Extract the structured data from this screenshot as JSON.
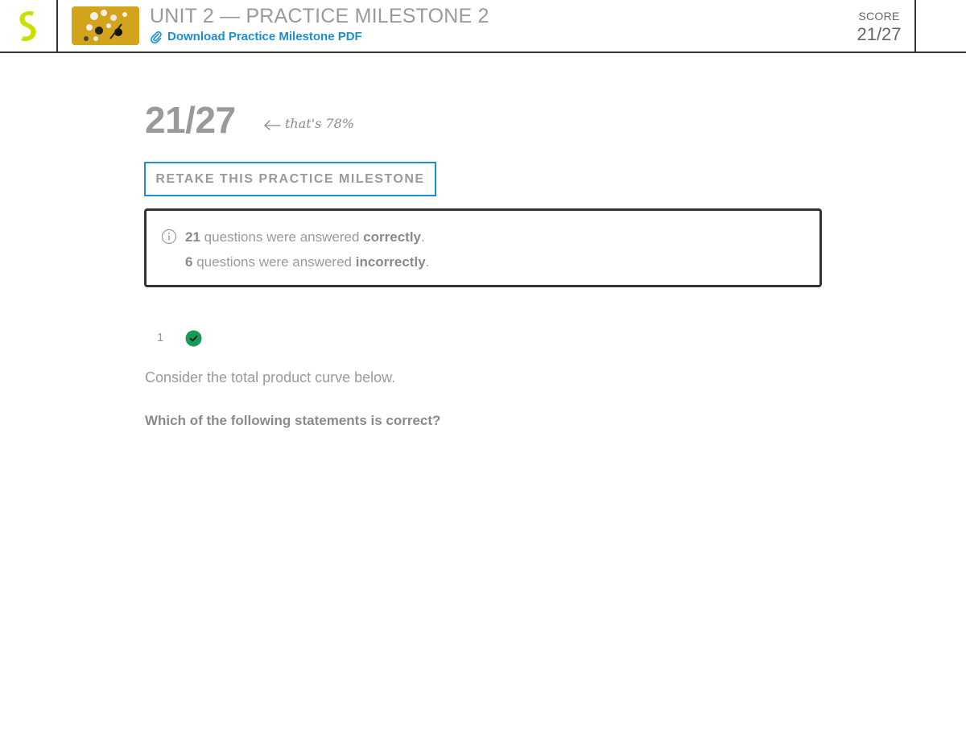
{
  "header": {
    "title": "UNIT 2 — PRACTICE MILESTONE 2",
    "download_label": "Download Practice Milestone PDF",
    "score_label": "SCORE",
    "score_value": "21/27"
  },
  "summary": {
    "score": "21/27",
    "percent_note": "that's 78%",
    "retake_label": "RETAKE THIS PRACTICE MILESTONE",
    "correct_count": "21",
    "correct_text": "questions were answered",
    "correct_word": "correctly",
    "incorrect_count": "6",
    "incorrect_text": "questions were answered",
    "incorrect_word": "incorrectly",
    "period": "."
  },
  "question": {
    "number": "1",
    "status": "correct",
    "text": "Consider the total product curve below.",
    "prompt": "Which of the following statements is correct?"
  },
  "colors": {
    "accent": "#1a8fd6",
    "logo": "#c8e000",
    "correct": "#1a9a5a",
    "border": "#333333"
  },
  "icons": [
    "logo-icon",
    "paperclip-icon",
    "arrow-left-icon",
    "info-icon",
    "check-circle-icon"
  ]
}
